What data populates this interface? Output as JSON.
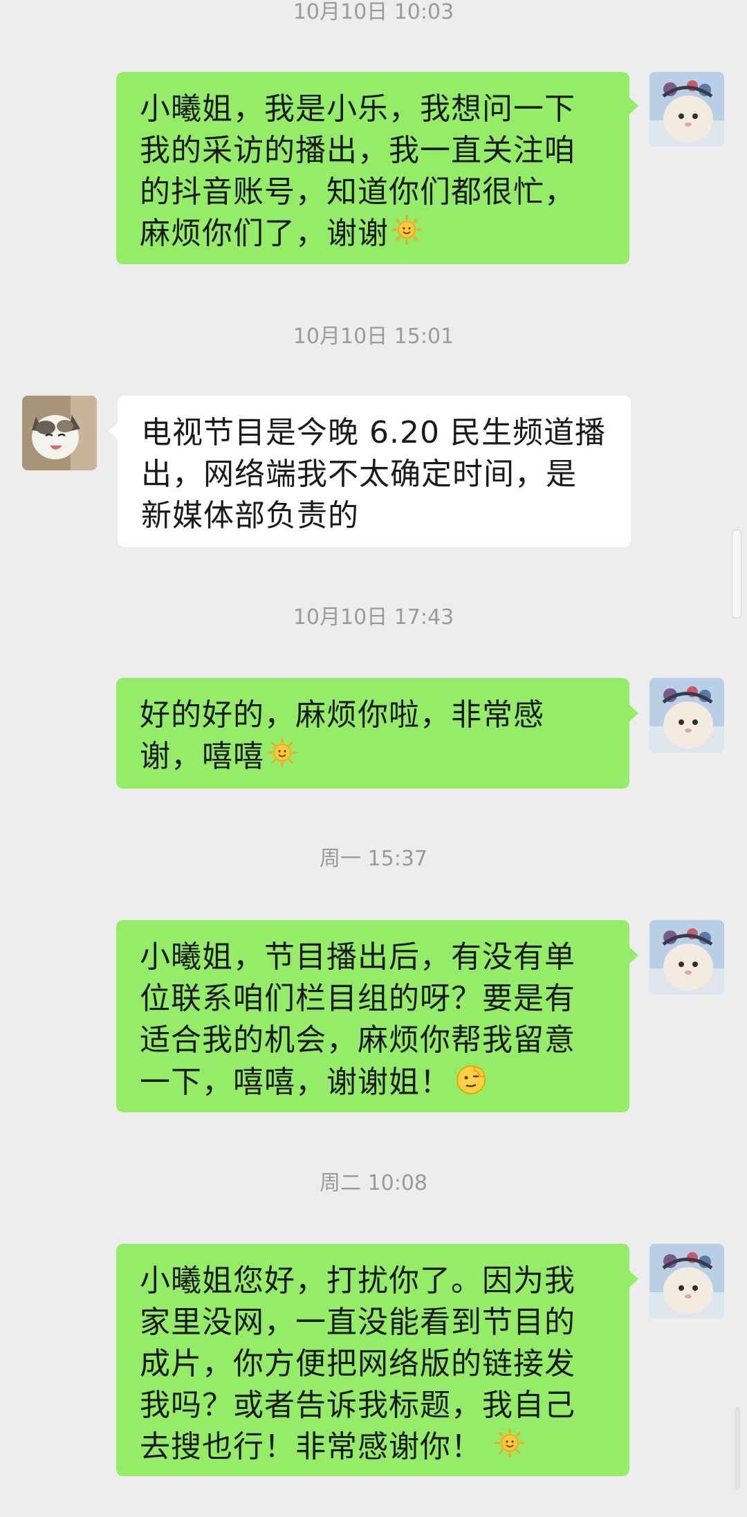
{
  "messages": [
    {
      "timestamp": "10月10日 10:03"
    },
    {
      "sender": "me",
      "text": "小曦姐，我是小乐，我想问一下我的采访的播出，我一直关注咱的抖音账号，知道你们都很忙，麻烦你们了，谢谢",
      "emoji": "sun-emoji"
    },
    {
      "timestamp": "10月10日 15:01"
    },
    {
      "sender": "other",
      "text": "电视节目是今晚 6.20 民生频道播出，网络端我不太确定时间，是新媒体部负责的"
    },
    {
      "timestamp": "10月10日 17:43"
    },
    {
      "sender": "me",
      "text": "好的好的，麻烦你啦，非常感谢，嘻嘻",
      "emoji": "sun-emoji"
    },
    {
      "timestamp": "周一 15:37"
    },
    {
      "sender": "me",
      "text": "小曦姐，节目播出后，有没有单位联系咱们栏目组的呀？要是有适合我的机会，麻烦你帮我留意一下，嘻嘻，谢谢姐！",
      "emoji": "salute-face-emoji"
    },
    {
      "timestamp": "周二 10:08"
    },
    {
      "sender": "me",
      "text": "小曦姐您好，打扰你了。因为我家里没网，一直没能看到节目的成片，你方便把网络版的链接发我吗？或者告诉我标题，我自己去搜也行！非常感谢你！",
      "emoji": "sun-emoji"
    }
  ],
  "colors": {
    "background": "#ededed",
    "my_bubble": "#95ec69",
    "other_bubble": "#ffffff",
    "timestamp_text": "#9a9a9a"
  }
}
